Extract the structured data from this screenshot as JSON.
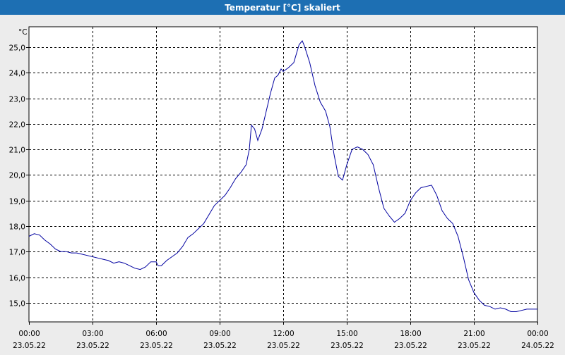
{
  "window": {
    "title": "Temperatur [°C] skaliert"
  },
  "colors": {
    "titlebar": "#1d6fb3",
    "line": "#0000a0",
    "grid": "#000000",
    "background": "#ffffff"
  },
  "chart_data": {
    "type": "line",
    "title": "Temperatur [°C] skaliert",
    "ylabel": "°C",
    "unit": "°C",
    "ylim": [
      14.25,
      25.8
    ],
    "xlim_hours": [
      0,
      24
    ],
    "grid": true,
    "grid_style": "dashed",
    "yticks": [
      {
        "value": 15.0,
        "label": "15,0"
      },
      {
        "value": 16.0,
        "label": "16,0"
      },
      {
        "value": 17.0,
        "label": "17,0"
      },
      {
        "value": 18.0,
        "label": "18,0"
      },
      {
        "value": 19.0,
        "label": "19,0"
      },
      {
        "value": 20.0,
        "label": "20,0"
      },
      {
        "value": 21.0,
        "label": "21,0"
      },
      {
        "value": 22.0,
        "label": "22,0"
      },
      {
        "value": 23.0,
        "label": "23,0"
      },
      {
        "value": 24.0,
        "label": "24,0"
      },
      {
        "value": 25.0,
        "label": "25,0"
      }
    ],
    "xticks": [
      {
        "hour": 0,
        "time": "00:00",
        "date": "23.05.22"
      },
      {
        "hour": 3,
        "time": "03:00",
        "date": "23.05.22"
      },
      {
        "hour": 6,
        "time": "06:00",
        "date": "23.05.22"
      },
      {
        "hour": 9,
        "time": "09:00",
        "date": "23.05.22"
      },
      {
        "hour": 12,
        "time": "12:00",
        "date": "23.05.22"
      },
      {
        "hour": 15,
        "time": "15:00",
        "date": "23.05.22"
      },
      {
        "hour": 18,
        "time": "18:00",
        "date": "23.05.22"
      },
      {
        "hour": 21,
        "time": "21:00",
        "date": "23.05.22"
      },
      {
        "hour": 24,
        "time": "00:00",
        "date": "24.05.22"
      }
    ],
    "series": [
      {
        "color": "#0000a0",
        "points": [
          [
            0.0,
            17.6
          ],
          [
            0.25,
            17.7
          ],
          [
            0.5,
            17.65
          ],
          [
            0.75,
            17.45
          ],
          [
            1.0,
            17.3
          ],
          [
            1.25,
            17.1
          ],
          [
            1.5,
            17.0
          ],
          [
            1.75,
            17.0
          ],
          [
            2.0,
            16.95
          ],
          [
            2.25,
            16.95
          ],
          [
            2.5,
            16.9
          ],
          [
            2.75,
            16.85
          ],
          [
            3.0,
            16.8
          ],
          [
            3.25,
            16.75
          ],
          [
            3.5,
            16.7
          ],
          [
            3.75,
            16.65
          ],
          [
            4.0,
            16.55
          ],
          [
            4.25,
            16.6
          ],
          [
            4.5,
            16.55
          ],
          [
            4.75,
            16.45
          ],
          [
            5.0,
            16.35
          ],
          [
            5.25,
            16.3
          ],
          [
            5.5,
            16.4
          ],
          [
            5.75,
            16.6
          ],
          [
            6.0,
            16.6
          ],
          [
            6.1,
            16.45
          ],
          [
            6.25,
            16.45
          ],
          [
            6.5,
            16.65
          ],
          [
            6.75,
            16.8
          ],
          [
            7.0,
            16.95
          ],
          [
            7.25,
            17.2
          ],
          [
            7.5,
            17.55
          ],
          [
            7.75,
            17.7
          ],
          [
            8.0,
            17.9
          ],
          [
            8.25,
            18.1
          ],
          [
            8.5,
            18.45
          ],
          [
            8.75,
            18.8
          ],
          [
            9.0,
            19.0
          ],
          [
            9.25,
            19.2
          ],
          [
            9.5,
            19.5
          ],
          [
            9.75,
            19.85
          ],
          [
            10.0,
            20.1
          ],
          [
            10.25,
            20.4
          ],
          [
            10.4,
            21.0
          ],
          [
            10.5,
            21.95
          ],
          [
            10.65,
            21.8
          ],
          [
            10.8,
            21.35
          ],
          [
            11.0,
            21.8
          ],
          [
            11.2,
            22.5
          ],
          [
            11.4,
            23.2
          ],
          [
            11.6,
            23.8
          ],
          [
            11.75,
            23.9
          ],
          [
            11.9,
            24.15
          ],
          [
            12.0,
            24.05
          ],
          [
            12.25,
            24.2
          ],
          [
            12.5,
            24.4
          ],
          [
            12.75,
            25.1
          ],
          [
            12.9,
            25.25
          ],
          [
            13.0,
            25.05
          ],
          [
            13.25,
            24.4
          ],
          [
            13.5,
            23.5
          ],
          [
            13.75,
            22.85
          ],
          [
            14.0,
            22.5
          ],
          [
            14.2,
            21.9
          ],
          [
            14.4,
            20.8
          ],
          [
            14.6,
            19.95
          ],
          [
            14.8,
            19.8
          ],
          [
            15.0,
            20.4
          ],
          [
            15.25,
            21.0
          ],
          [
            15.5,
            21.1
          ],
          [
            15.75,
            21.0
          ],
          [
            16.0,
            20.8
          ],
          [
            16.25,
            20.4
          ],
          [
            16.5,
            19.5
          ],
          [
            16.75,
            18.7
          ],
          [
            17.0,
            18.4
          ],
          [
            17.25,
            18.15
          ],
          [
            17.5,
            18.3
          ],
          [
            17.75,
            18.5
          ],
          [
            18.0,
            19.0
          ],
          [
            18.25,
            19.3
          ],
          [
            18.5,
            19.5
          ],
          [
            18.75,
            19.55
          ],
          [
            19.0,
            19.6
          ],
          [
            19.25,
            19.2
          ],
          [
            19.5,
            18.6
          ],
          [
            19.75,
            18.3
          ],
          [
            20.0,
            18.1
          ],
          [
            20.25,
            17.6
          ],
          [
            20.5,
            16.8
          ],
          [
            20.75,
            15.9
          ],
          [
            21.0,
            15.4
          ],
          [
            21.25,
            15.1
          ],
          [
            21.5,
            14.9
          ],
          [
            21.75,
            14.85
          ],
          [
            22.0,
            14.75
          ],
          [
            22.25,
            14.8
          ],
          [
            22.5,
            14.75
          ],
          [
            22.75,
            14.65
          ],
          [
            23.0,
            14.65
          ],
          [
            23.25,
            14.7
          ],
          [
            23.5,
            14.75
          ],
          [
            23.75,
            14.75
          ],
          [
            24.0,
            14.75
          ]
        ]
      }
    ]
  }
}
